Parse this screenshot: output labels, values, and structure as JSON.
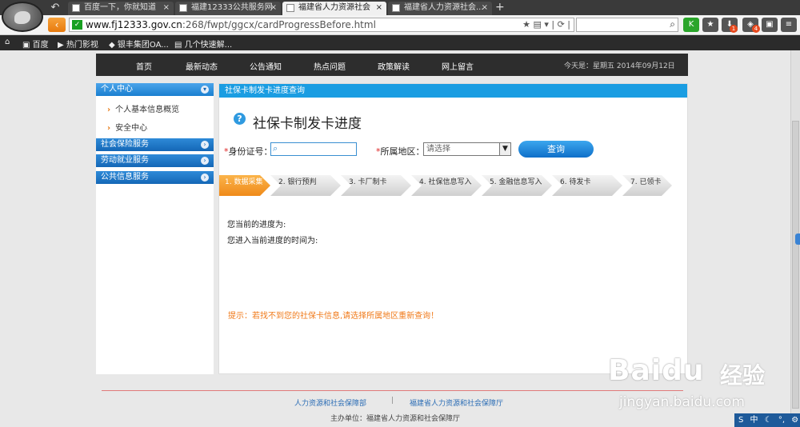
{
  "browser": {
    "tabs": [
      {
        "label": "百度一下，你就知道",
        "active": false
      },
      {
        "label": "福建12333公共服务网",
        "active": false
      },
      {
        "label": "福建省人力资源社会",
        "active": true
      },
      {
        "label": "福建省人力资源社会...",
        "active": false
      }
    ],
    "close_glyph": "×",
    "new_tab_glyph": "+",
    "address": {
      "domain": "www.fj12333.gov.cn",
      "path": ":268/fwpt/ggcx/cardProgressBefore.html",
      "secure_glyph": "✓"
    },
    "bookmarks": [
      "百度",
      "热门影视",
      "银丰集团OA...",
      "几个快速解..."
    ],
    "toolbar_badges": [
      "1",
      "4"
    ]
  },
  "nav": {
    "items": [
      "首页",
      "最新动态",
      "公告通知",
      "热点问题",
      "政策解读",
      "网上留言"
    ],
    "date_text": "今天是：星期五  2014年09月12日"
  },
  "sidebar": {
    "sections": [
      {
        "label": "个人中心"
      },
      {
        "label": "社会保险服务"
      },
      {
        "label": "劳动就业服务"
      },
      {
        "label": "公共信息服务"
      }
    ],
    "sub_items": [
      "个人基本信息概览",
      "安全中心"
    ],
    "arrow": "›"
  },
  "main": {
    "bar_title": "社保卡制发卡进度查询",
    "heading": "社保卡制发卡进度",
    "question_glyph": "?",
    "required_mark": "*",
    "id_label": "身份证号：",
    "region_label": "所属地区：",
    "region_placeholder": "请选择",
    "query_button": "查询",
    "steps": [
      "1. 数据采集",
      "2. 银行预判",
      "3. 卡厂制卡",
      "4. 社保信息写入",
      "5. 金融信息写入",
      "6. 待发卡",
      "7. 已领卡"
    ],
    "current_progress_label": "您当前的进度为:",
    "enter_time_label": "您进入当前进度的时间为:",
    "tip": "提示：若找不到您的社保卡信息,请选择所属地区重新查询！"
  },
  "footer": {
    "link1": "人力资源和社会保障部",
    "separator": "|",
    "link2": "福建省人力资源和社会保障厅",
    "host": "主办单位：福建省人力资源和社会保障厅"
  },
  "watermark": {
    "brand": "Baidu",
    "suffix": "经验",
    "url": "jingyan.baidu.com"
  },
  "ime": {
    "items": [
      "中",
      "☾",
      "°,",
      "⚙"
    ]
  }
}
